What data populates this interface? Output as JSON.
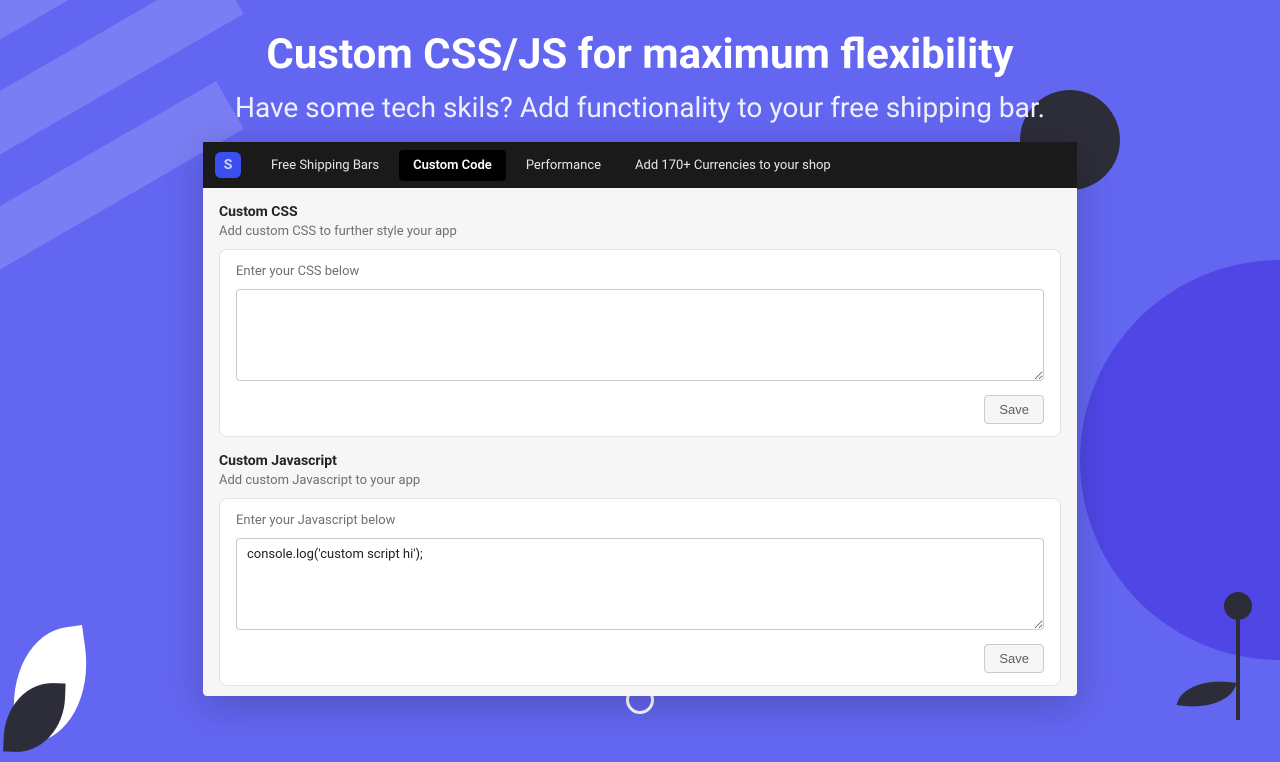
{
  "hero": {
    "title": "Custom CSS/JS for maximum flexibility",
    "subtitle": "Have some tech skils? Add functionality to your free shipping bar."
  },
  "nav": {
    "logo": "S",
    "items": [
      {
        "label": "Free Shipping Bars",
        "active": false
      },
      {
        "label": "Custom Code",
        "active": true
      },
      {
        "label": "Performance",
        "active": false
      },
      {
        "label": "Add 170+ Currencies to your shop",
        "active": false
      }
    ]
  },
  "css_section": {
    "title": "Custom CSS",
    "subtitle": "Add custom CSS to further style your app",
    "card_label": "Enter your CSS below",
    "value": "",
    "save_label": "Save"
  },
  "js_section": {
    "title": "Custom Javascript",
    "subtitle": "Add custom Javascript to your app",
    "card_label": "Enter your Javascript below",
    "value": "console.log('custom script hi');",
    "save_label": "Save"
  }
}
